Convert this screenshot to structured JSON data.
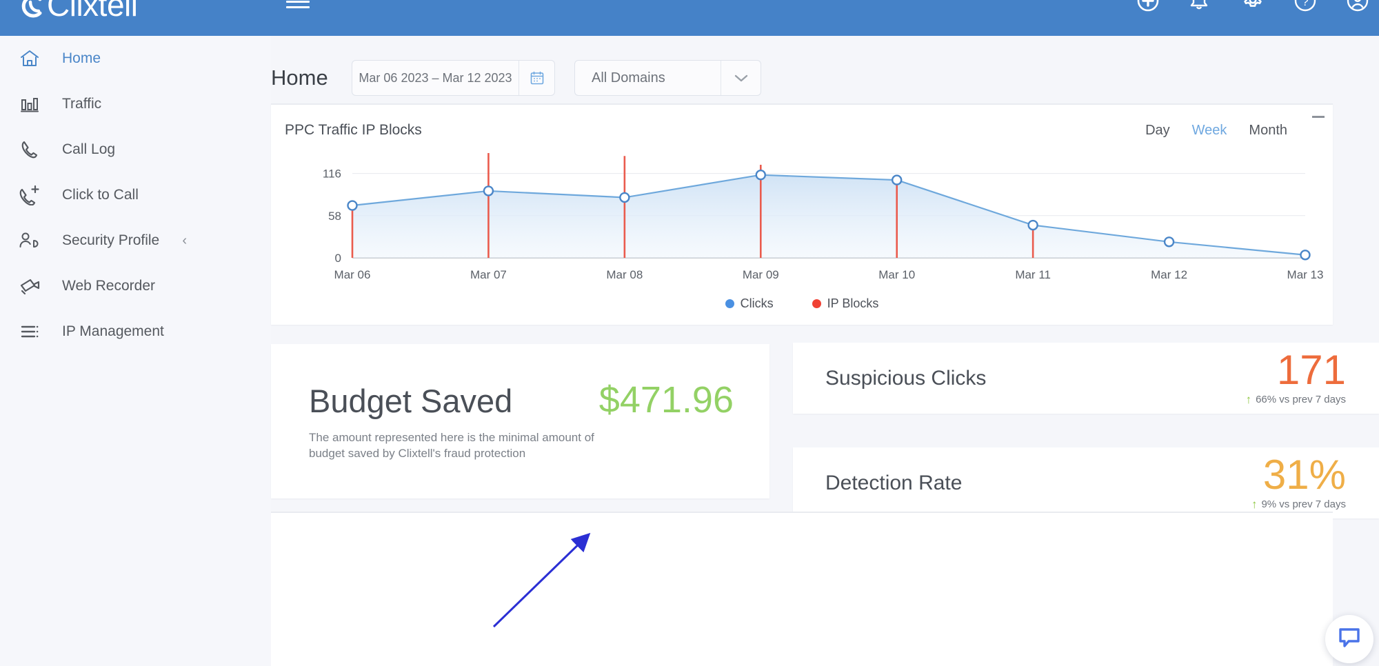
{
  "app": {
    "brand": "Clixtell",
    "brand_icon": "clixtell-logo-icon"
  },
  "topbar": {
    "menu_icon": "hamburger-menu-icon",
    "icons": [
      {
        "name": "add-circle-icon",
        "label": "Add"
      },
      {
        "name": "notifications-bell-icon",
        "label": "Notifications",
        "has_badge": true
      },
      {
        "name": "settings-gear-icon",
        "label": "Settings"
      },
      {
        "name": "help-question-icon",
        "label": "Help"
      },
      {
        "name": "user-account-icon",
        "label": "Account"
      }
    ]
  },
  "sidebar": {
    "items": [
      {
        "label": "Home",
        "icon": "home-icon",
        "active": true,
        "chevron": ""
      },
      {
        "label": "Traffic",
        "icon": "bar-chart-icon",
        "active": false,
        "chevron": ""
      },
      {
        "label": "Call Log",
        "icon": "phone-icon",
        "active": false,
        "chevron": ""
      },
      {
        "label": "Click to Call",
        "icon": "phone-plus-icon",
        "active": false,
        "chevron": ""
      },
      {
        "label": "Security Profile",
        "icon": "user-shield-icon",
        "active": false,
        "chevron": "‹"
      },
      {
        "label": "Web Recorder",
        "icon": "video-camera-icon",
        "active": false,
        "chevron": ""
      },
      {
        "label": "IP Management",
        "icon": "list-icon",
        "active": false,
        "chevron": ""
      }
    ]
  },
  "page": {
    "title": "Home"
  },
  "daterange": {
    "value": "Mar 06 2023 – Mar 12 2023",
    "icon": "calendar-icon"
  },
  "domain_select": {
    "value": "All Domains",
    "icon": "chevron-down-icon"
  },
  "chart_card": {
    "title": "PPC Traffic IP Blocks",
    "tabs": [
      {
        "label": "Day",
        "active": false
      },
      {
        "label": "Week",
        "active": true
      },
      {
        "label": "Month",
        "active": false
      }
    ],
    "minimize_icon": "minimize-icon"
  },
  "chart_data": {
    "type": "line",
    "title": "PPC Traffic IP Blocks",
    "xlabel": "",
    "ylabel": "",
    "ylim": [
      0,
      145
    ],
    "yticks": [
      0,
      58,
      116
    ],
    "grid": true,
    "legend_position": "bottom",
    "categories": [
      "Mar 06",
      "Mar 07",
      "Mar 08",
      "Mar 09",
      "Mar 10",
      "Mar 11",
      "Mar 12",
      "Mar 13"
    ],
    "series": [
      {
        "name": "Clicks",
        "type": "area-line",
        "color": "#6ea8dc",
        "values": [
          72,
          92,
          83,
          114,
          107,
          45,
          22,
          4
        ]
      },
      {
        "name": "IP Blocks",
        "type": "stem",
        "color": "#ea5b4d",
        "values": [
          70,
          144,
          140,
          128,
          108,
          38,
          0,
          0
        ]
      }
    ]
  },
  "budget_card": {
    "label": "Budget Saved",
    "value": "$471.96",
    "description": "The amount represented here is the minimal amount of budget saved by Clixtell's fraud protection",
    "value_color": "#93d165"
  },
  "stats": [
    {
      "label": "Suspicious Clicks",
      "value": "171",
      "value_color": "#ed6c3c",
      "delta_arrow": "↑",
      "delta_text": "66% vs prev 7 days"
    },
    {
      "label": "Detection Rate",
      "value": "31%",
      "value_color": "#efae47",
      "delta_arrow": "↑",
      "delta_text": "9% vs prev 7 days"
    }
  ],
  "annotation": {
    "name": "blue-arrow-annotation",
    "color": "#2b2fd4"
  },
  "chat_widget": {
    "icon": "chat-bubble-icon",
    "color": "#4a73e8"
  }
}
